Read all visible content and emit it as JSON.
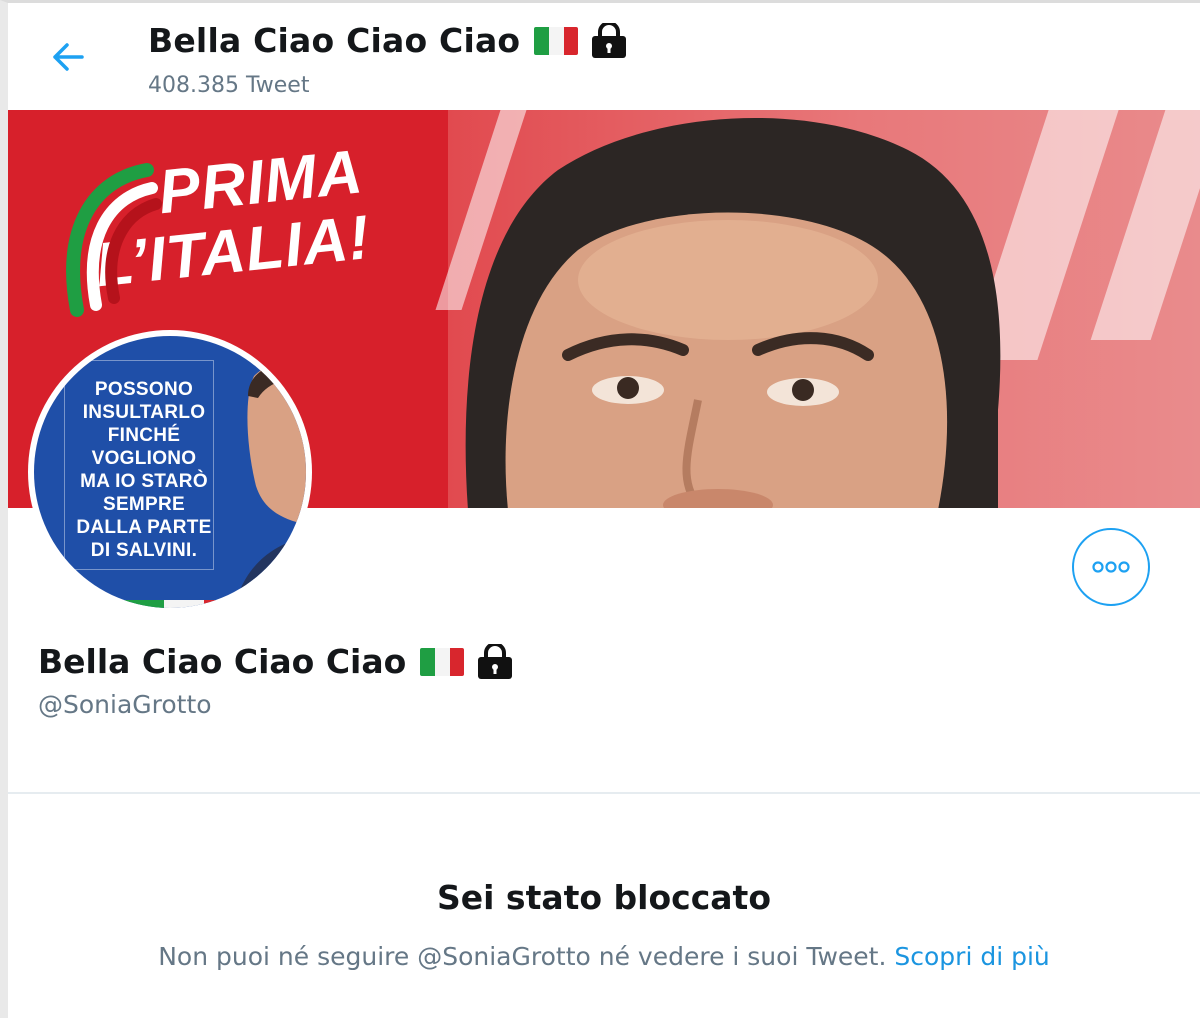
{
  "header": {
    "title": "Bella Ciao Ciao Ciao",
    "tweet_count": "408.385 Tweet"
  },
  "banner": {
    "slogan_line1": "PRIMA",
    "slogan_line2": "L’ITALIA!"
  },
  "avatar": {
    "lines": [
      "POSSONO",
      "INSULTARLO",
      "FINCHÉ",
      "VOGLIONO",
      "MA IO STARÒ",
      "SEMPRE",
      "DALLA PARTE",
      "DI SALVINI."
    ]
  },
  "profile": {
    "name": "Bella Ciao Ciao Ciao",
    "handle": "@SoniaGrotto"
  },
  "blocked": {
    "title": "Sei stato bloccato",
    "message": "Non puoi né seguire @SoniaGrotto né vedere i suoi Tweet.",
    "link": "Scopri di più"
  },
  "icons": {
    "back": "back-arrow-icon",
    "more": "more-options-icon",
    "lock": "lock-icon",
    "flag": "italy-flag-icon"
  },
  "colors": {
    "accent": "#1da1f2",
    "banner_red": "#d7202b",
    "avatar_blue": "#1f4fa8",
    "secondary_text": "#657786"
  }
}
